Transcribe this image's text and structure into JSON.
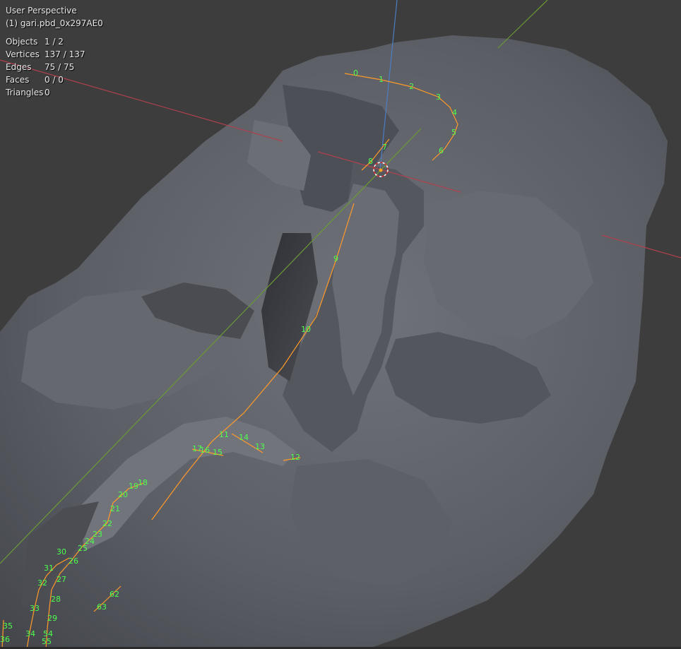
{
  "viewport": {
    "view_name": "User Perspective",
    "object_info": "(1) gari.pbd_0x297AE0",
    "stats": [
      {
        "label": "Objects",
        "value": "1 / 2"
      },
      {
        "label": "Vertices",
        "value": "137 / 137"
      },
      {
        "label": "Edges",
        "value": "75 / 75"
      },
      {
        "label": "Faces",
        "value": "0 / 0"
      },
      {
        "label": "Triangles",
        "value": "0"
      }
    ]
  },
  "colors": {
    "background": "#3d3d3d",
    "mesh": "#5f6168",
    "x_axis": "#b0404f",
    "y_axis": "#6b9a35",
    "z_axis": "#4d7ec2",
    "edge_selected": "#ff9a28",
    "vertex_index": "#4dff4d"
  },
  "vertex_indices": [
    "0",
    "1",
    "2",
    "3",
    "4",
    "5",
    "6",
    "7",
    "8",
    "9",
    "10",
    "11",
    "12",
    "13",
    "14",
    "15",
    "16",
    "17",
    "18",
    "19",
    "20",
    "21",
    "22",
    "23",
    "24",
    "25",
    "26",
    "27",
    "28",
    "29",
    "30",
    "31",
    "32",
    "33",
    "34",
    "35",
    "36",
    "54",
    "55",
    "62",
    "63"
  ]
}
